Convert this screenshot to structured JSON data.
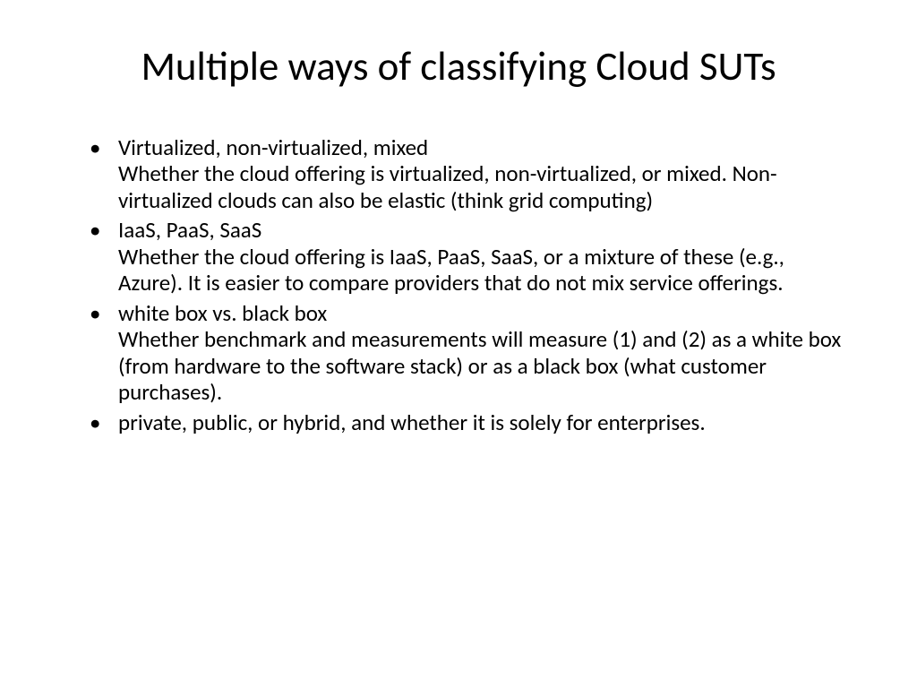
{
  "slide": {
    "title": "Multiple ways of classifying Cloud SUTs",
    "bullets": [
      {
        "lead": "Virtualized, non-virtualized, mixed",
        "desc": "Whether the cloud offering is virtualized, non-virtualized, or mixed. Non-virtualized clouds can also be elastic (think grid computing)"
      },
      {
        "lead": "IaaS, PaaS, SaaS",
        "desc": "Whether the cloud offering is IaaS, PaaS, SaaS, or a mixture of these (e.g., Azure). It is easier to compare providers that do not mix service offerings."
      },
      {
        "lead": "white box vs. black box",
        "desc": "Whether benchmark and measurements will measure (1) and (2) as a white box (from hardware to the software stack) or as a black box (what customer purchases)."
      },
      {
        "lead": "private, public, or hybrid, and whether it is solely for enterprises.",
        "desc": ""
      }
    ]
  }
}
